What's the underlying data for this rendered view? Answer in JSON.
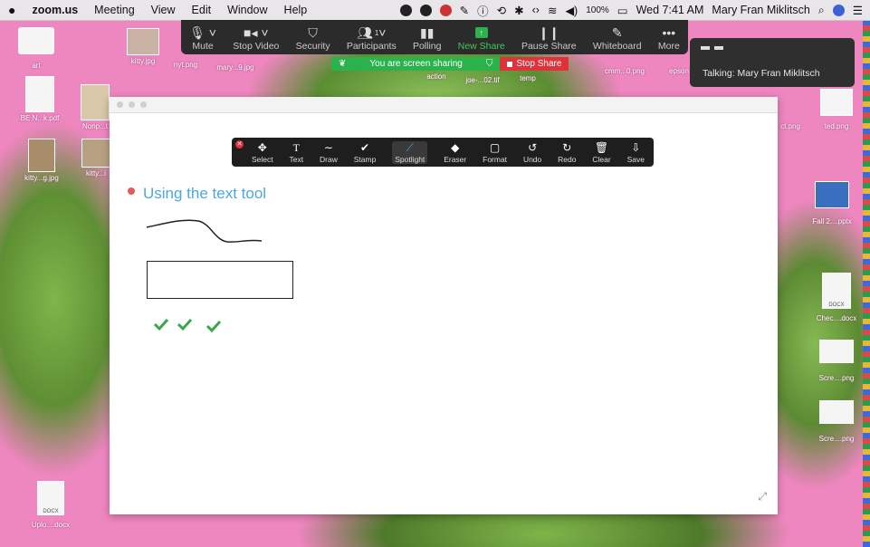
{
  "menubar": {
    "apple": "",
    "app": "zoom.us",
    "items": [
      "Meeting",
      "View",
      "Edit",
      "Window",
      "Help"
    ],
    "battery": "100%",
    "clock": "Wed 7:41 AM",
    "user": "Mary Fran Miklitsch"
  },
  "toolbar": {
    "mute": "Mute",
    "stop_video": "Stop Video",
    "security": "Security",
    "participants": "Participants",
    "participants_count": "1",
    "polling": "Polling",
    "new_share": "New Share",
    "pause_share": "Pause Share",
    "whiteboard": "Whiteboard",
    "more": "More"
  },
  "sharing": {
    "status": "You are screen sharing",
    "stop": "Stop Share"
  },
  "talking": "Talking: Mary Fran Miklitsch",
  "annotate": {
    "select": "Select",
    "text": "Text",
    "draw": "Draw",
    "stamp": "Stamp",
    "spotlight": "Spotlight",
    "eraser": "Eraser",
    "format": "Format",
    "undo": "Undo",
    "redo": "Redo",
    "clear": "Clear",
    "save": "Save"
  },
  "whiteboard": {
    "heading": "Using the text tool"
  },
  "desktop": {
    "icons": {
      "art": "art",
      "ben": "BE N...k.pdf",
      "nonp": "Nonp...t",
      "kitty1": "kitty...g.jpg",
      "kitty2": "kitty...i",
      "kittyjpg": "kitty.jpg",
      "nyt": "nyt.png",
      "mary": "mary...9.jpg",
      "receipts": "receipts",
      "action": "action",
      "joe": "joe-...02.tif",
      "temp": "temp",
      "cmm": "cmm...0.png",
      "epson": "epson",
      "ct": "ct.png",
      "ted": "ted.png",
      "fall": "Fall 2....pptx",
      "check": "Chec....docx",
      "scre1": "Scre....png",
      "scre2": "Scre....png",
      "uplo": "Uplo....docx",
      "docx_badge": "DOCX"
    }
  },
  "colors": {
    "desktop_pink": "#ee86bf",
    "share_green": "#2bb24c",
    "stop_red": "#e0323b",
    "heading_blue": "#4aa8e0",
    "check_green": "#3aa64a"
  }
}
